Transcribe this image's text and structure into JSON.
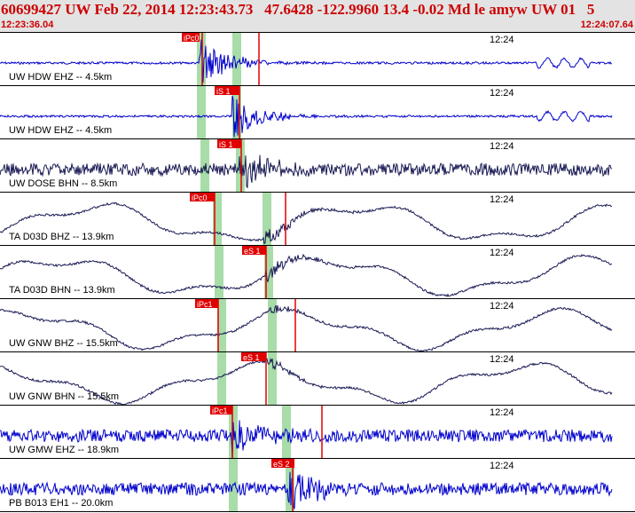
{
  "header": {
    "title": "60699427 UW Feb 22, 2014 12:23:43.73   47.6428 -122.9960 13.4 -0.02 Md le amyw UW 01   5",
    "start_time": "12:23:36.04",
    "end_time": "12:24:07.64"
  },
  "colors": {
    "header_bg": "#e3e3e3",
    "header_text": "#cc0000",
    "trace_blue": "#0000cc",
    "trace_navy": "#1a1a55",
    "pick_red": "#e00000",
    "window_green": "#a8dca8"
  },
  "traces": [
    {
      "label": "UW HDW EHZ -- 4.5km",
      "time": "12:24",
      "color": "blue",
      "pick": "iPc0"
    },
    {
      "label": "UW HDW EHZ -- 4.5km",
      "time": "12:24",
      "color": "blue",
      "pick": "iS 1"
    },
    {
      "label": "UW DOSE BHN -- 8.5km",
      "time": "12:24",
      "color": "navy",
      "pick": "iS 1"
    },
    {
      "label": "TA D03D BHZ -- 13.9km",
      "time": "12:24",
      "color": "navy",
      "pick": "iPc0"
    },
    {
      "label": "TA D03D BHN -- 13.9km",
      "time": "12:24",
      "color": "navy",
      "pick": "eS 1"
    },
    {
      "label": "UW GNW BHZ -- 15.5km",
      "time": "12:24",
      "color": "navy",
      "pick": "iPc1"
    },
    {
      "label": "UW GNW BHN -- 15.5km",
      "time": "12:24",
      "color": "navy",
      "pick": "eS 1"
    },
    {
      "label": "UW GMW EHZ -- 18.9km",
      "time": "12:24",
      "color": "blue",
      "pick": "iPc1"
    },
    {
      "label": "PB B013 EH1 -- 20.0km",
      "time": "12:24",
      "color": "blue",
      "pick": "eS 2"
    }
  ]
}
